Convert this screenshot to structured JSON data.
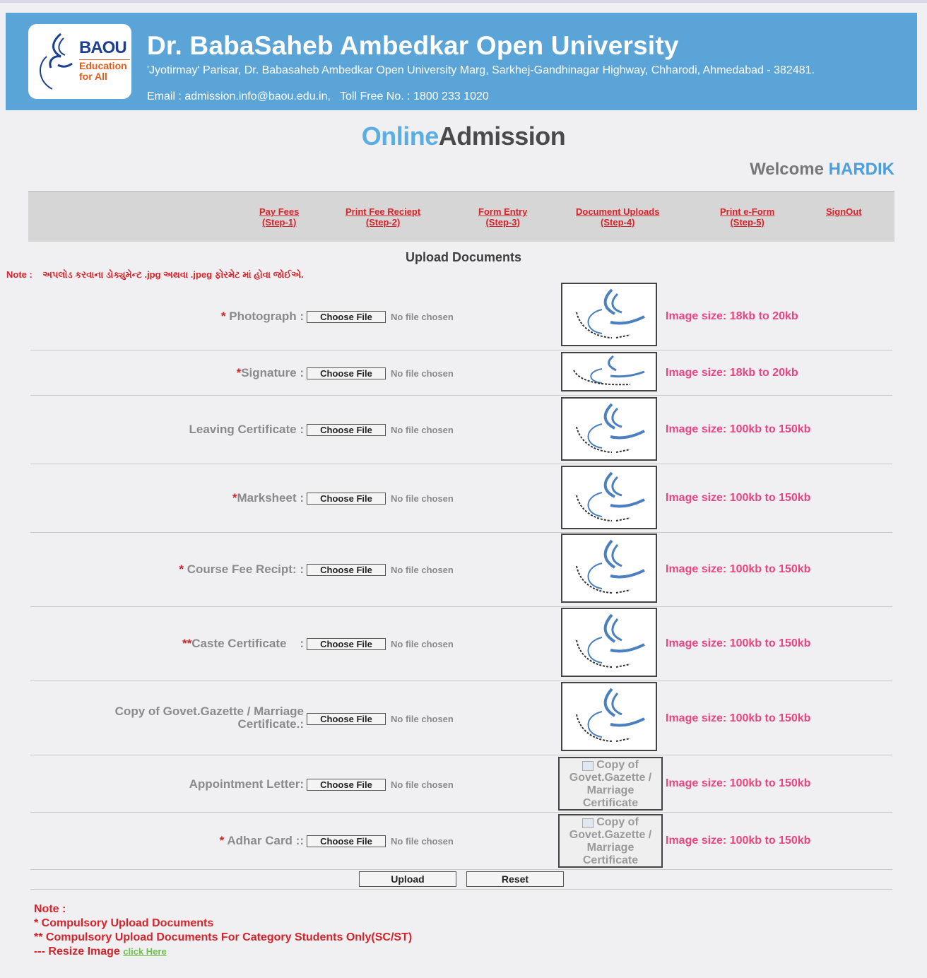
{
  "header": {
    "logo_word": "BAOU",
    "logo_tagline_1": "Education",
    "logo_tagline_2": "for All",
    "university_name": "Dr. BabaSaheb Ambedkar Open University",
    "address": "'Jyotirmay' Parisar, Dr. Babasaheb Ambedkar Open University Marg, Sarkhej-Gandhinagar Highway, Chharodi, Ahmedabad - 382481.",
    "contact": "Email : admission.info@baou.edu.in,   Toll Free No. : 1800 233 1020"
  },
  "title": {
    "part1": "Online",
    "part2": "Admission"
  },
  "welcome": {
    "label": "Welcome ",
    "user": "HARDIK"
  },
  "nav": [
    {
      "label": "Pay Fees",
      "step": "(Step-1)"
    },
    {
      "label": "Print Fee Reciept",
      "step": "(Step-2)"
    },
    {
      "label": "Form Entry",
      "step": "(Step-3)"
    },
    {
      "label": "Document Uploads",
      "step": "(Step-4)"
    },
    {
      "label": "Print e-Form",
      "step": "(Step-5)"
    },
    {
      "label": "SignOut",
      "step": ""
    }
  ],
  "section_title": "Upload Documents",
  "note_top": "Note :    અપલોડ કરવાના ડોક્યુમેન્ટ .jpg અથવા .jpeg ફોરમેટ માં હોવા જોઈએ.",
  "file_button_label": "Choose File",
  "no_file_text": "No file chosen",
  "documents": [
    {
      "req": "* ",
      "label": "Photograph :",
      "size": "Image size: 18kb to 20kb"
    },
    {
      "req": "*",
      "label": "Signature :",
      "size": "Image size: 18kb to 20kb"
    },
    {
      "req": "",
      "label": "Leaving Certificate :",
      "size": "Image size: 100kb to 150kb"
    },
    {
      "req": "*",
      "label": "Marksheet :",
      "size": "Image size: 100kb to 150kb"
    },
    {
      "req": "* ",
      "label": "Course Fee Recipt: :",
      "size": "Image size: 100kb to 150kb"
    },
    {
      "req": "**",
      "label": "Caste Certificate    :",
      "size": "Image size: 100kb to 150kb"
    },
    {
      "req": "",
      "label": "Copy of Govet.Gazette / Marriage",
      "label2": "Certificate.:",
      "size": "Image size: 100kb to 150kb"
    },
    {
      "req": "",
      "label": "Appointment Letter:",
      "size": "Image size: 100kb to 150kb",
      "broken_alt": "Copy of Govet.Gazette / Marriage Certificate"
    },
    {
      "req": "* ",
      "label": "Adhar Card ::",
      "size": "Image size: 100kb to 150kb",
      "broken_alt": "Copy of Govet.Gazette / Marriage Certificate"
    }
  ],
  "buttons": {
    "upload": "Upload",
    "reset": "Reset"
  },
  "footer": {
    "note": "Note :",
    "line1": "* Compulsory Upload Documents",
    "line2": "** Compulsory Upload Documents For Category Students Only(SC/ST)",
    "line3": "--- Resize Image ",
    "link": "click Here"
  },
  "colors": {
    "header_bg": "#5aa4d8",
    "accent_red": "#d8222a",
    "size_pink": "#e8467c",
    "welcome_blue": "#4b9fdc"
  }
}
